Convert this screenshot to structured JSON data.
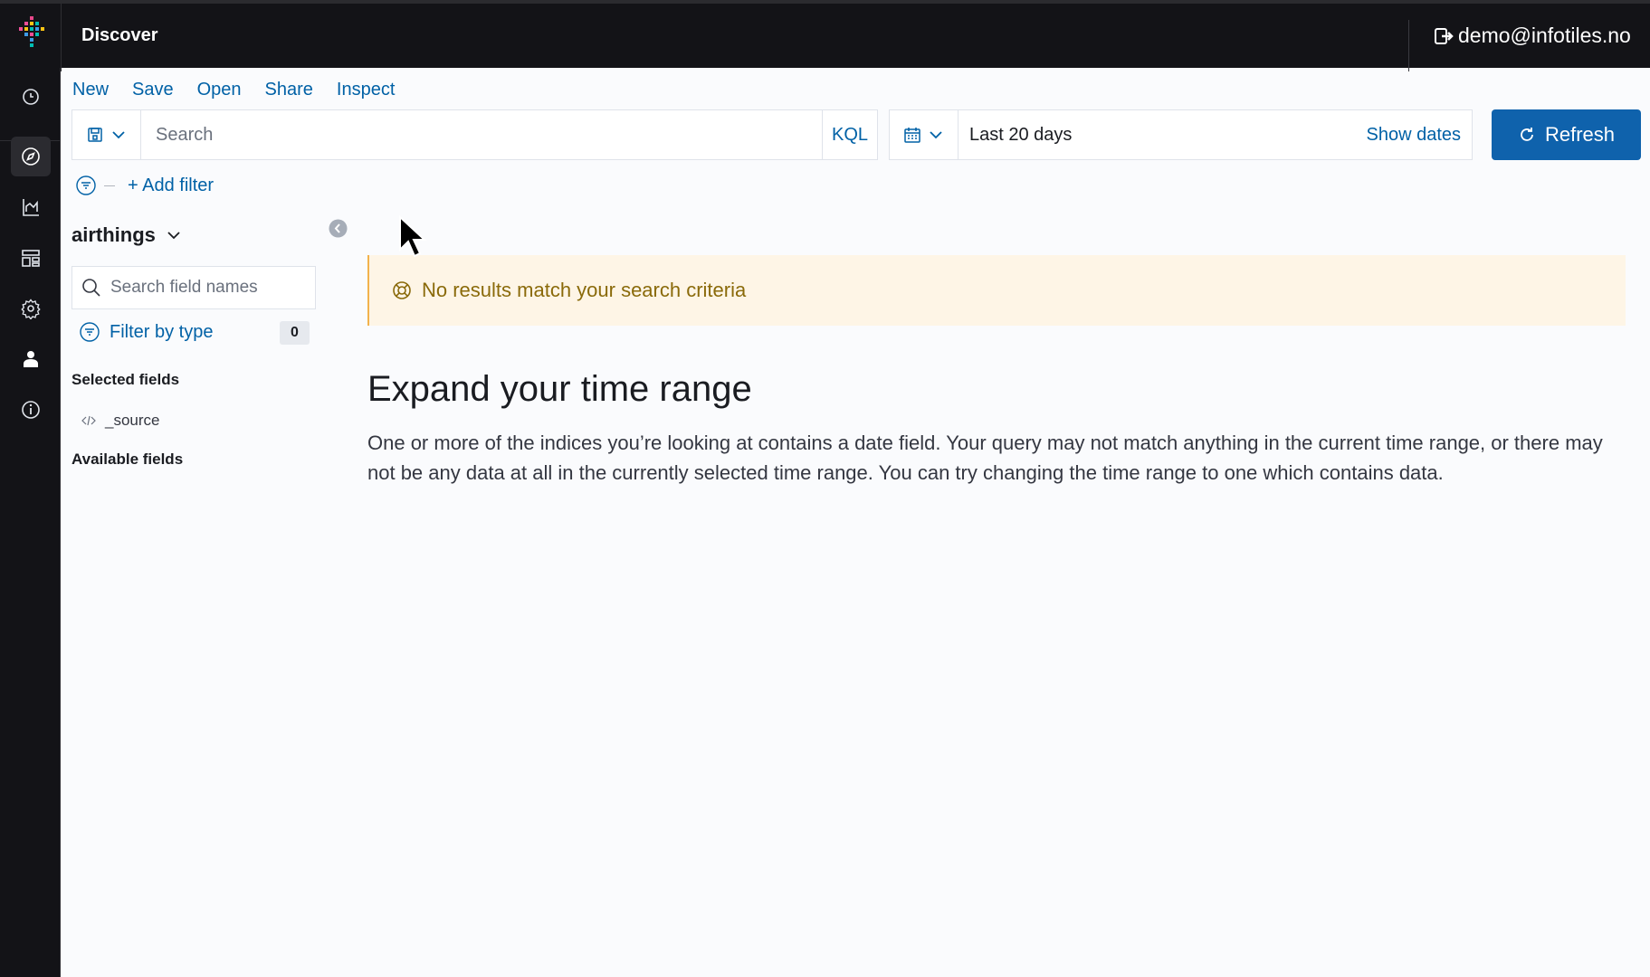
{
  "app": {
    "title": "Discover",
    "user_email": "demo@infotiles.no"
  },
  "sidebar": {
    "items": [
      {
        "name": "recently-viewed",
        "icon": "clock-icon"
      },
      {
        "name": "discover",
        "icon": "compass-icon",
        "active": true
      },
      {
        "name": "visualize",
        "icon": "chart-icon"
      },
      {
        "name": "dashboard",
        "icon": "dashboard-icon"
      },
      {
        "name": "management",
        "icon": "gear-icon"
      },
      {
        "name": "security",
        "icon": "user-icon"
      },
      {
        "name": "about",
        "icon": "info-icon"
      }
    ]
  },
  "menu": {
    "new": "New",
    "save": "Save",
    "open": "Open",
    "share": "Share",
    "inspect": "Inspect"
  },
  "query": {
    "placeholder": "Search",
    "language": "KQL"
  },
  "time": {
    "range": "Last 20 days",
    "show_dates": "Show dates",
    "refresh": "Refresh"
  },
  "filters": {
    "add_filter": "+ Add filter"
  },
  "fields_panel": {
    "index_pattern": "airthings",
    "search_placeholder": "Search field names",
    "filter_by_type": "Filter by type",
    "filter_count": "0",
    "selected_fields_title": "Selected fields",
    "selected_fields": [
      "_source"
    ],
    "available_fields_title": "Available fields"
  },
  "results": {
    "callout": "No results match your search criteria",
    "title": "Expand your time range",
    "body": "One or more of the indices you’re looking at contains a date field. Your query may not match anything in the current time range, or there may not be any data at all in the currently selected time range. You can try changing the time range to one which contains data."
  },
  "colors": {
    "accent": "#0061a6",
    "refresh_bg": "#0f62ac",
    "header_bg": "#131317",
    "callout_bg": "#fef5e6",
    "callout_text": "#8a6a0a"
  }
}
